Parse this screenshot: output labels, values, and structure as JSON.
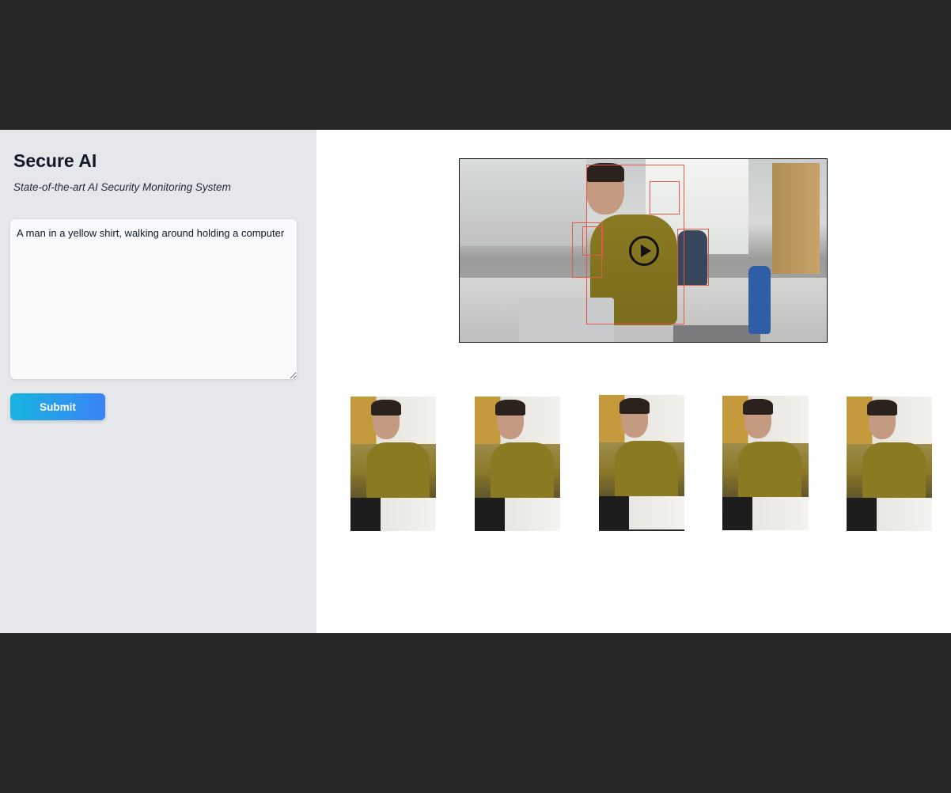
{
  "app": {
    "title": "Secure AI",
    "subtitle": "State-of-the-art AI Security Monitoring System"
  },
  "query": {
    "value": "A man in a yellow shirt, walking around holding a computer"
  },
  "submit": {
    "label": "Submit"
  },
  "colors": {
    "sidebar_bg": "#e5e7eb",
    "button_gradient_start": "#18b4e0",
    "button_gradient_end": "#3b82f6",
    "bbox": "#e4584a"
  },
  "video": {
    "icon": "play-icon"
  },
  "results": {
    "count": 5
  }
}
